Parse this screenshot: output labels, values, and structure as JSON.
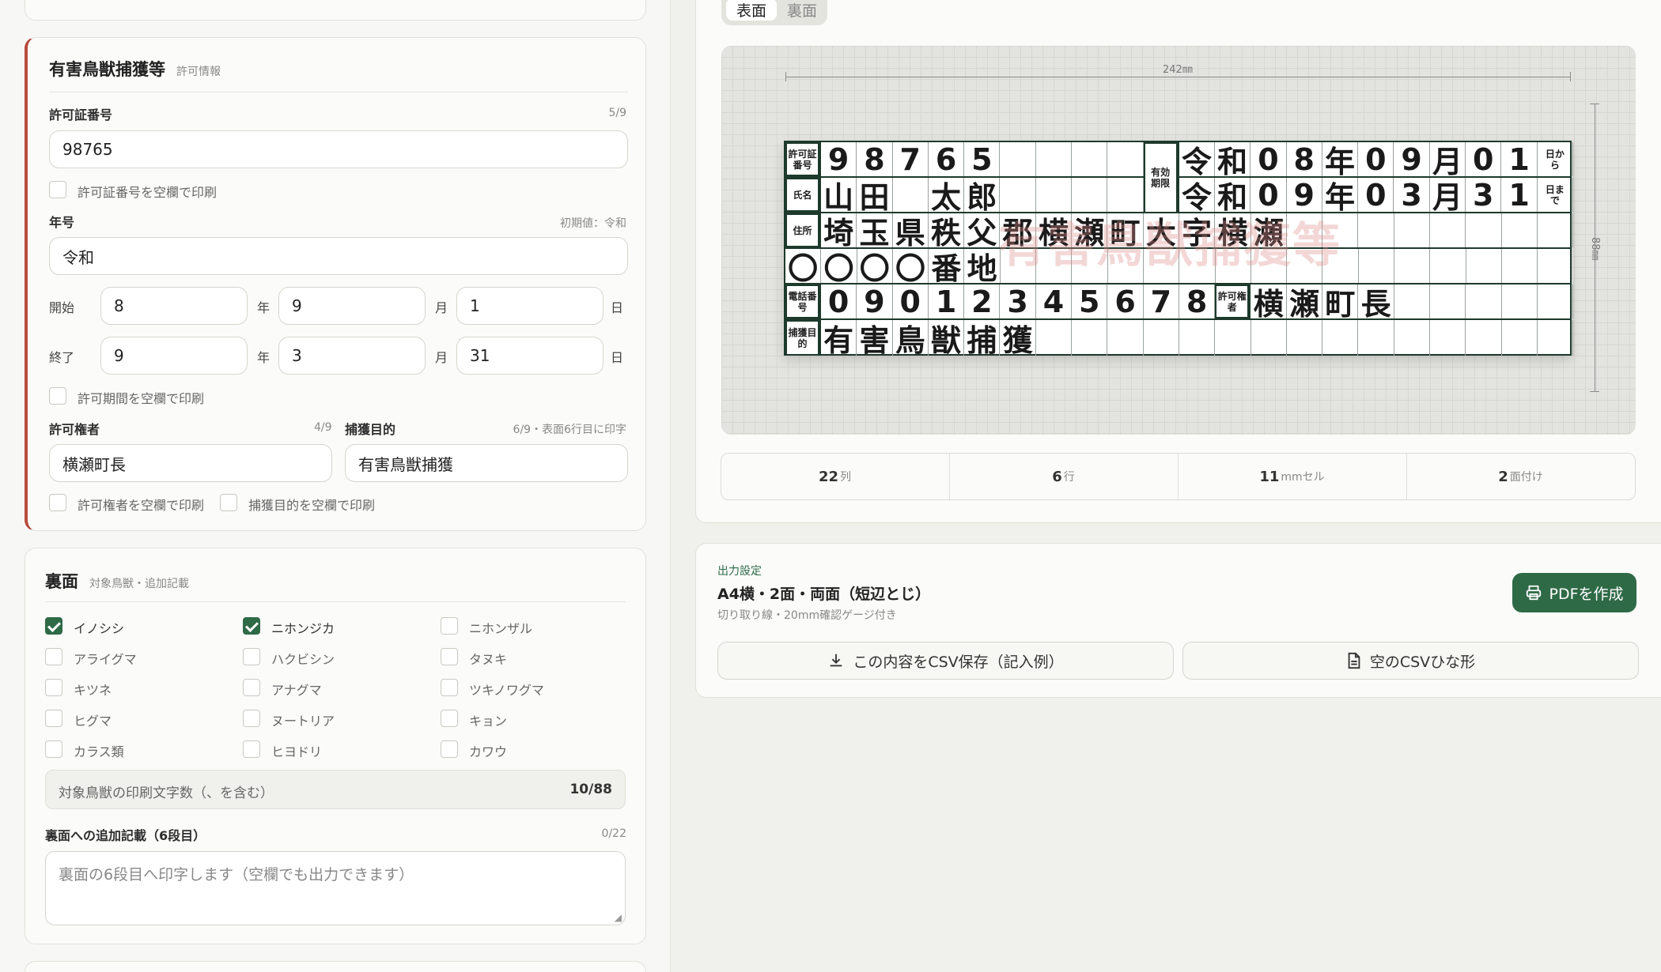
{
  "permit": {
    "title": "有害鳥獣捕獲等",
    "subtitle": "許可情報",
    "permit_no_label": "許可証番号",
    "permit_no_count": "5/9",
    "permit_no_value": "98765",
    "permit_no_blank_label": "許可証番号を空欄で印刷",
    "era_label": "年号",
    "era_hint": "初期値：令和",
    "era_value": "令和",
    "start_label": "開始",
    "start_year": "8",
    "start_month": "9",
    "start_day": "1",
    "end_label": "終了",
    "end_year": "9",
    "end_month": "3",
    "end_day": "31",
    "unit_year": "年",
    "unit_month": "月",
    "unit_day": "日",
    "period_blank_label": "許可期間を空欄で印刷",
    "authority_label": "許可権者",
    "authority_count": "4/9",
    "authority_value": "横瀬町長",
    "purpose_label": "捕獲目的",
    "purpose_count": "6/9・表面6行目に印字",
    "purpose_value": "有害鳥獣捕獲",
    "authority_blank_label": "許可権者を空欄で印刷",
    "purpose_blank_label": "捕獲目的を空欄で印刷"
  },
  "back": {
    "title": "裏面",
    "subtitle": "対象鳥獣・追加記載",
    "animals": [
      {
        "label": "イノシシ",
        "checked": true
      },
      {
        "label": "ニホンジカ",
        "checked": true
      },
      {
        "label": "ニホンザル",
        "checked": false
      },
      {
        "label": "アライグマ",
        "checked": false
      },
      {
        "label": "ハクビシン",
        "checked": false
      },
      {
        "label": "タヌキ",
        "checked": false
      },
      {
        "label": "キツネ",
        "checked": false
      },
      {
        "label": "アナグマ",
        "checked": false
      },
      {
        "label": "ツキノワグマ",
        "checked": false
      },
      {
        "label": "ヒグマ",
        "checked": false
      },
      {
        "label": "ヌートリア",
        "checked": false
      },
      {
        "label": "キョン",
        "checked": false
      },
      {
        "label": "カラス類",
        "checked": false
      },
      {
        "label": "ヒヨドリ",
        "checked": false
      },
      {
        "label": "カワウ",
        "checked": false
      }
    ],
    "char_count_label": "対象鳥獣の印刷文字数（、を含む）",
    "char_count_value": "10/88",
    "extra_label": "裏面への追加記載（6段目）",
    "extra_count": "0/22",
    "extra_placeholder": "裏面の6段目へ印字します（空欄でも出力できます）"
  },
  "preview": {
    "tabs": [
      "表面",
      "裏面"
    ],
    "width_label": "242㎜",
    "height_label": "88㎜",
    "hdr_permit_no": "許可証番号",
    "hdr_name": "氏名",
    "hdr_valid": "有効期限",
    "hdr_address": "住所",
    "hdr_phone": "電話番号",
    "hdr_authority": "許可権者",
    "hdr_purpose": "捕獲目的",
    "from_label": "日から",
    "until_label": "日まで",
    "permit_chars": [
      "9",
      "8",
      "7",
      "6",
      "5"
    ],
    "valid_from_chars": [
      "令",
      "和",
      "0",
      "8",
      "年",
      "0",
      "9",
      "月",
      "0",
      "1"
    ],
    "name_chars": [
      "山",
      "田",
      "",
      "太",
      "郎"
    ],
    "valid_to_chars": [
      "令",
      "和",
      "0",
      "9",
      "年",
      "0",
      "3",
      "月",
      "3",
      "1"
    ],
    "address1_chars": [
      "埼",
      "玉",
      "県",
      "秩",
      "父",
      "郡",
      "横",
      "瀬",
      "町",
      "大",
      "字",
      "横",
      "瀬"
    ],
    "address2_chars": [
      "〇",
      "〇",
      "〇",
      "〇",
      "番",
      "地"
    ],
    "phone_chars": [
      "0",
      "9",
      "0",
      "1",
      "2",
      "3",
      "4",
      "5",
      "6",
      "7",
      "8"
    ],
    "authority_chars": [
      "横",
      "瀬",
      "町",
      "長"
    ],
    "purpose_chars": [
      "有",
      "害",
      "鳥",
      "獣",
      "捕",
      "獲"
    ],
    "watermark": "有害鳥獣捕獲等"
  },
  "stats": [
    {
      "value": "22",
      "unit": "列"
    },
    {
      "value": "6",
      "unit": "行"
    },
    {
      "value": "11",
      "unit": "mmセル"
    },
    {
      "value": "2",
      "unit": "面付け"
    }
  ],
  "output": {
    "section_label": "出力設定",
    "title": "A4横・2面・両面（短辺とじ）",
    "note": "切り取り線・20mm確認ゲージ付き",
    "pdf_button": "PDFを作成",
    "csv_save_button": "この内容をCSV保存（記入例）",
    "csv_template_button": "空のCSVひな形"
  },
  "colors": {
    "accent": "#2f6a47",
    "permit_border": "#b84a3c",
    "grid_line": "#1d3a2c"
  }
}
